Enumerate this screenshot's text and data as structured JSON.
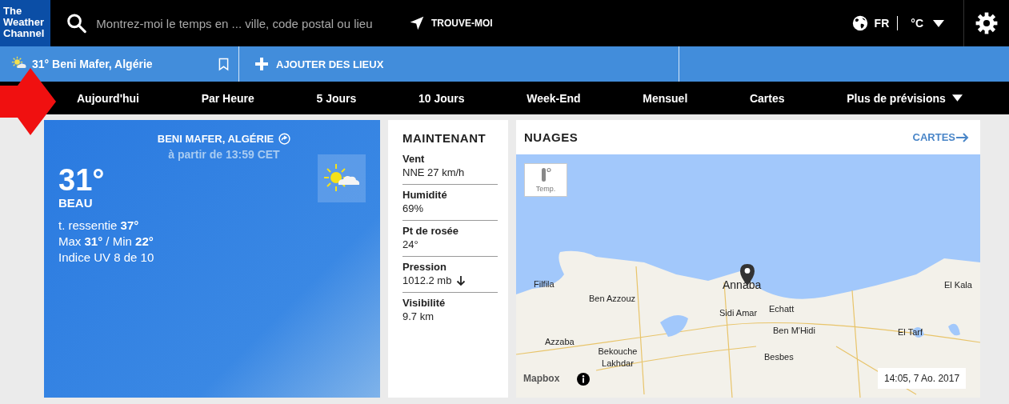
{
  "header": {
    "logo": "The Weather Channel",
    "search_placeholder": "Montrez-moi le temps en ... ville, code postal ou lieu",
    "locate_label": "TROUVE-MOI",
    "language": "FR",
    "unit": "°C"
  },
  "locations_bar": {
    "saved": {
      "temp": "31°",
      "name": "Beni Mafer, Algérie"
    },
    "add_label": "AJOUTER DES LIEUX"
  },
  "nav": [
    {
      "label": "Aujourd'hui",
      "dropdown": false
    },
    {
      "label": "Par Heure",
      "dropdown": false
    },
    {
      "label": "5 Jours",
      "dropdown": false
    },
    {
      "label": "10 Jours",
      "dropdown": false
    },
    {
      "label": "Week-End",
      "dropdown": false
    },
    {
      "label": "Mensuel",
      "dropdown": false
    },
    {
      "label": "Cartes",
      "dropdown": false
    },
    {
      "label": "Plus de prévisions",
      "dropdown": true
    }
  ],
  "current": {
    "location": "BENI MAFER, ALGÉRIE",
    "as_of": "à partir de 13:59 CET",
    "temp": "31°",
    "condition": "BEAU",
    "details": [
      "t. ressentie **37°**",
      "Max **31°** / Min **22°**",
      "Indice UV 8 de 10"
    ]
  },
  "now": {
    "title": "MAINTENANT",
    "items": [
      {
        "label": "Vent",
        "value": "NNE 27 km/h",
        "kind": "plain"
      },
      {
        "label": "Humidité",
        "value": "69%",
        "kind": "plain"
      },
      {
        "label": "Pt de rosée",
        "value": "24°",
        "kind": "plain"
      },
      {
        "label": "Pression",
        "value": "1012.2 mb",
        "kind": "falling"
      },
      {
        "label": "Visibilité",
        "value": "9.7 km",
        "kind": "plain"
      }
    ]
  },
  "map": {
    "title": "NUAGES",
    "link": "CARTES",
    "layer_button": "Temp.",
    "attribution": "Mapbox",
    "timestamp": "14:05, 7 Ao. 2017",
    "places": [
      {
        "name": "Filfila"
      },
      {
        "name": "Ben Azzouz"
      },
      {
        "name": "Annaba"
      },
      {
        "name": "Sidi Amar"
      },
      {
        "name": "Echatt"
      },
      {
        "name": "Ben M'Hidi"
      },
      {
        "name": "El Kala"
      },
      {
        "name": "El Tarf"
      },
      {
        "name": "Azzaba"
      },
      {
        "name": "Bekouche Lakhdar"
      },
      {
        "name": "Besbes"
      }
    ]
  }
}
